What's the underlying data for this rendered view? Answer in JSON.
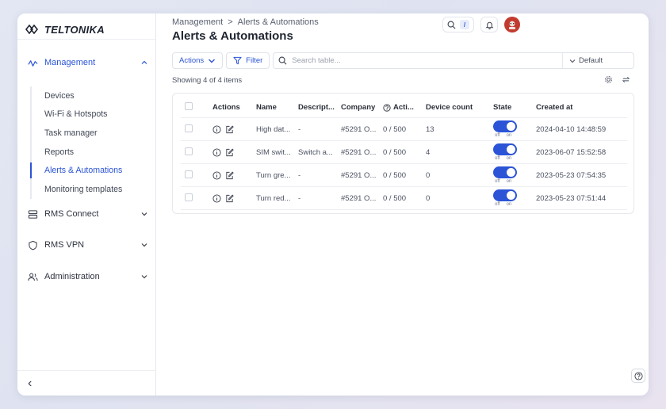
{
  "brand": {
    "name": "TELTONIKA"
  },
  "sidebar": {
    "sections": [
      {
        "label": "Management",
        "icon": "activity-icon",
        "expanded": true
      },
      {
        "label": "RMS Connect",
        "icon": "server-icon",
        "expanded": false
      },
      {
        "label": "RMS VPN",
        "icon": "shield-icon",
        "expanded": false
      },
      {
        "label": "Administration",
        "icon": "users-icon",
        "expanded": false
      }
    ],
    "management_items": [
      {
        "label": "Devices"
      },
      {
        "label": "Wi-Fi & Hotspots"
      },
      {
        "label": "Task manager"
      },
      {
        "label": "Reports"
      },
      {
        "label": "Alerts & Automations",
        "active": true
      },
      {
        "label": "Monitoring templates"
      }
    ],
    "collapse_glyph": "‹"
  },
  "header": {
    "breadcrumb": [
      "Management",
      "Alerts & Automations"
    ],
    "breadcrumb_sep": ">",
    "title": "Alerts & Automations",
    "search_shortcut": "/"
  },
  "toolbar": {
    "actions_label": "Actions",
    "filter_label": "Filter",
    "search_placeholder": "Search table...",
    "view_selected": "Default"
  },
  "table": {
    "showing_text": "Showing 4 of 4 items",
    "columns": [
      "Actions",
      "Name",
      "Descript...",
      "Company",
      "Acti...",
      "Device count",
      "State",
      "Created at"
    ],
    "toggle_off": "off",
    "toggle_on": "on",
    "rows": [
      {
        "name": "High dat...",
        "description": "-",
        "company": "#5291 O...",
        "actions": "0 / 500",
        "device_count": "13",
        "state": "on",
        "created_at": "2024-04-10 14:48:59"
      },
      {
        "name": "SIM swit...",
        "description": "Switch a...",
        "company": "#5291 O...",
        "actions": "0 / 500",
        "device_count": "4",
        "state": "on",
        "created_at": "2023-06-07 15:52:58"
      },
      {
        "name": "Turn gre...",
        "description": "-",
        "company": "#5291 O...",
        "actions": "0 / 500",
        "device_count": "0",
        "state": "on",
        "created_at": "2023-05-23 07:54:35"
      },
      {
        "name": "Turn red...",
        "description": "-",
        "company": "#5291 O...",
        "actions": "0 / 500",
        "device_count": "0",
        "state": "on",
        "created_at": "2023-05-23 07:51:44"
      }
    ]
  },
  "colors": {
    "accent": "#2b54d6",
    "avatar": "#c33a2f"
  }
}
